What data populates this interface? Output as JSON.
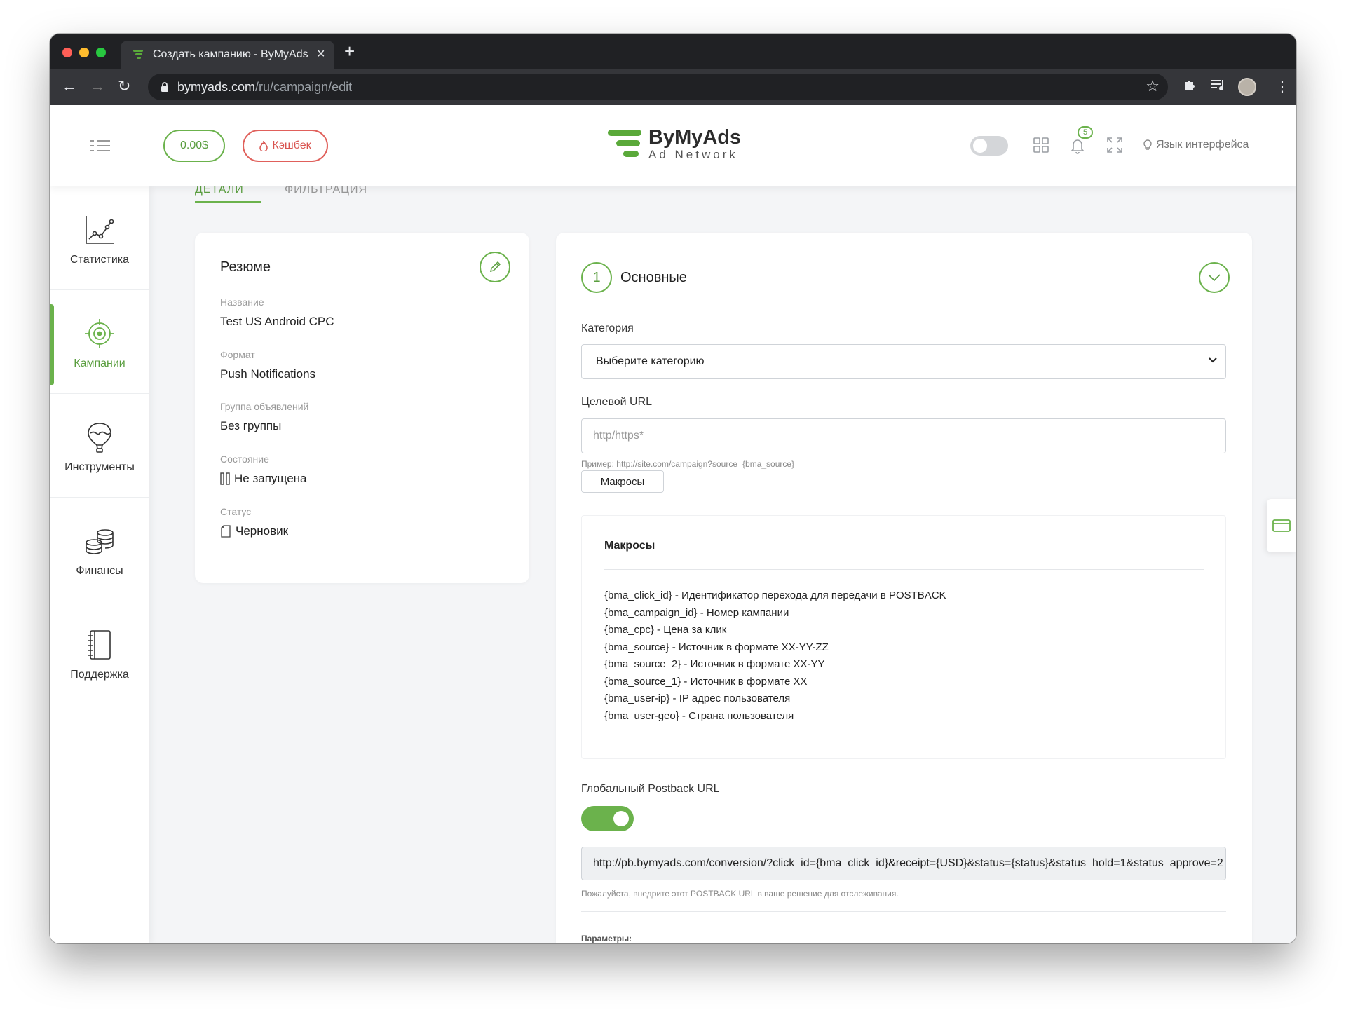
{
  "browser": {
    "tab_title": "Создать кампанию - ByMyAds",
    "url_host": "bymyads.com",
    "url_path": "/ru/campaign/edit"
  },
  "header": {
    "balance": "0.00$",
    "cashback": "Кэшбек",
    "logo_brand": "ByMyAds",
    "logo_tagline": "Ad Network",
    "notifications_count": "5",
    "language_label": "Язык интерфейса"
  },
  "sidebar": {
    "items": [
      {
        "label": "Статистика",
        "icon": "chart-icon"
      },
      {
        "label": "Кампании",
        "icon": "target-icon",
        "active": true
      },
      {
        "label": "Инструменты",
        "icon": "balloon-icon"
      },
      {
        "label": "Финансы",
        "icon": "coins-icon"
      },
      {
        "label": "Поддержка",
        "icon": "notebook-icon"
      }
    ]
  },
  "tabs": [
    "ДЕТАЛИ",
    "ФИЛЬТРАЦИЯ"
  ],
  "summary": {
    "title": "Резюме",
    "fields": [
      {
        "key": "Название",
        "value": "Test US Android CPC"
      },
      {
        "key": "Формат",
        "value": "Push Notifications"
      },
      {
        "key": "Группа объявлений",
        "value": "Без группы"
      },
      {
        "key": "Состояние",
        "value": "Не запущена"
      },
      {
        "key": "Статус",
        "value": "Черновик"
      }
    ]
  },
  "form": {
    "step_number": "1",
    "step_title": "Основные",
    "category_label": "Категория",
    "category_value": "Выберите категорию",
    "target_url_label": "Целевой URL",
    "target_url_placeholder": "http/https*",
    "example_hint": "Пример: http://site.com/campaign?source={bma_source}",
    "macros_button": "Макросы",
    "macros_title": "Макросы",
    "macros": [
      "{bma_click_id} - Идентификатор перехода для передачи в POSTBACK",
      "{bma_campaign_id} - Номер кампании",
      "{bma_cpc} - Цена за клик",
      "{bma_source} - Источник в формате XX-YY-ZZ",
      "{bma_source_2} - Источник в формате XX-YY",
      "{bma_source_1} - Источник в формате XX",
      "{bma_user-ip} - IP адрес пользователя",
      "{bma_user-geo} - Страна пользователя"
    ],
    "postback_label": "Глобальный Postback URL",
    "postback_enabled": true,
    "postback_url": "http://pb.bymyads.com/conversion/?click_id={bma_click_id}&receipt={USD}&status={status}&status_hold=1&status_approve=2",
    "postback_hint": "Пожалуйста, внедрите этот POSTBACK URL в ваше решение для отслеживания.",
    "params_label": "Параметры:"
  },
  "colors": {
    "accent": "#6bb24c",
    "cashback": "#d9534f"
  }
}
